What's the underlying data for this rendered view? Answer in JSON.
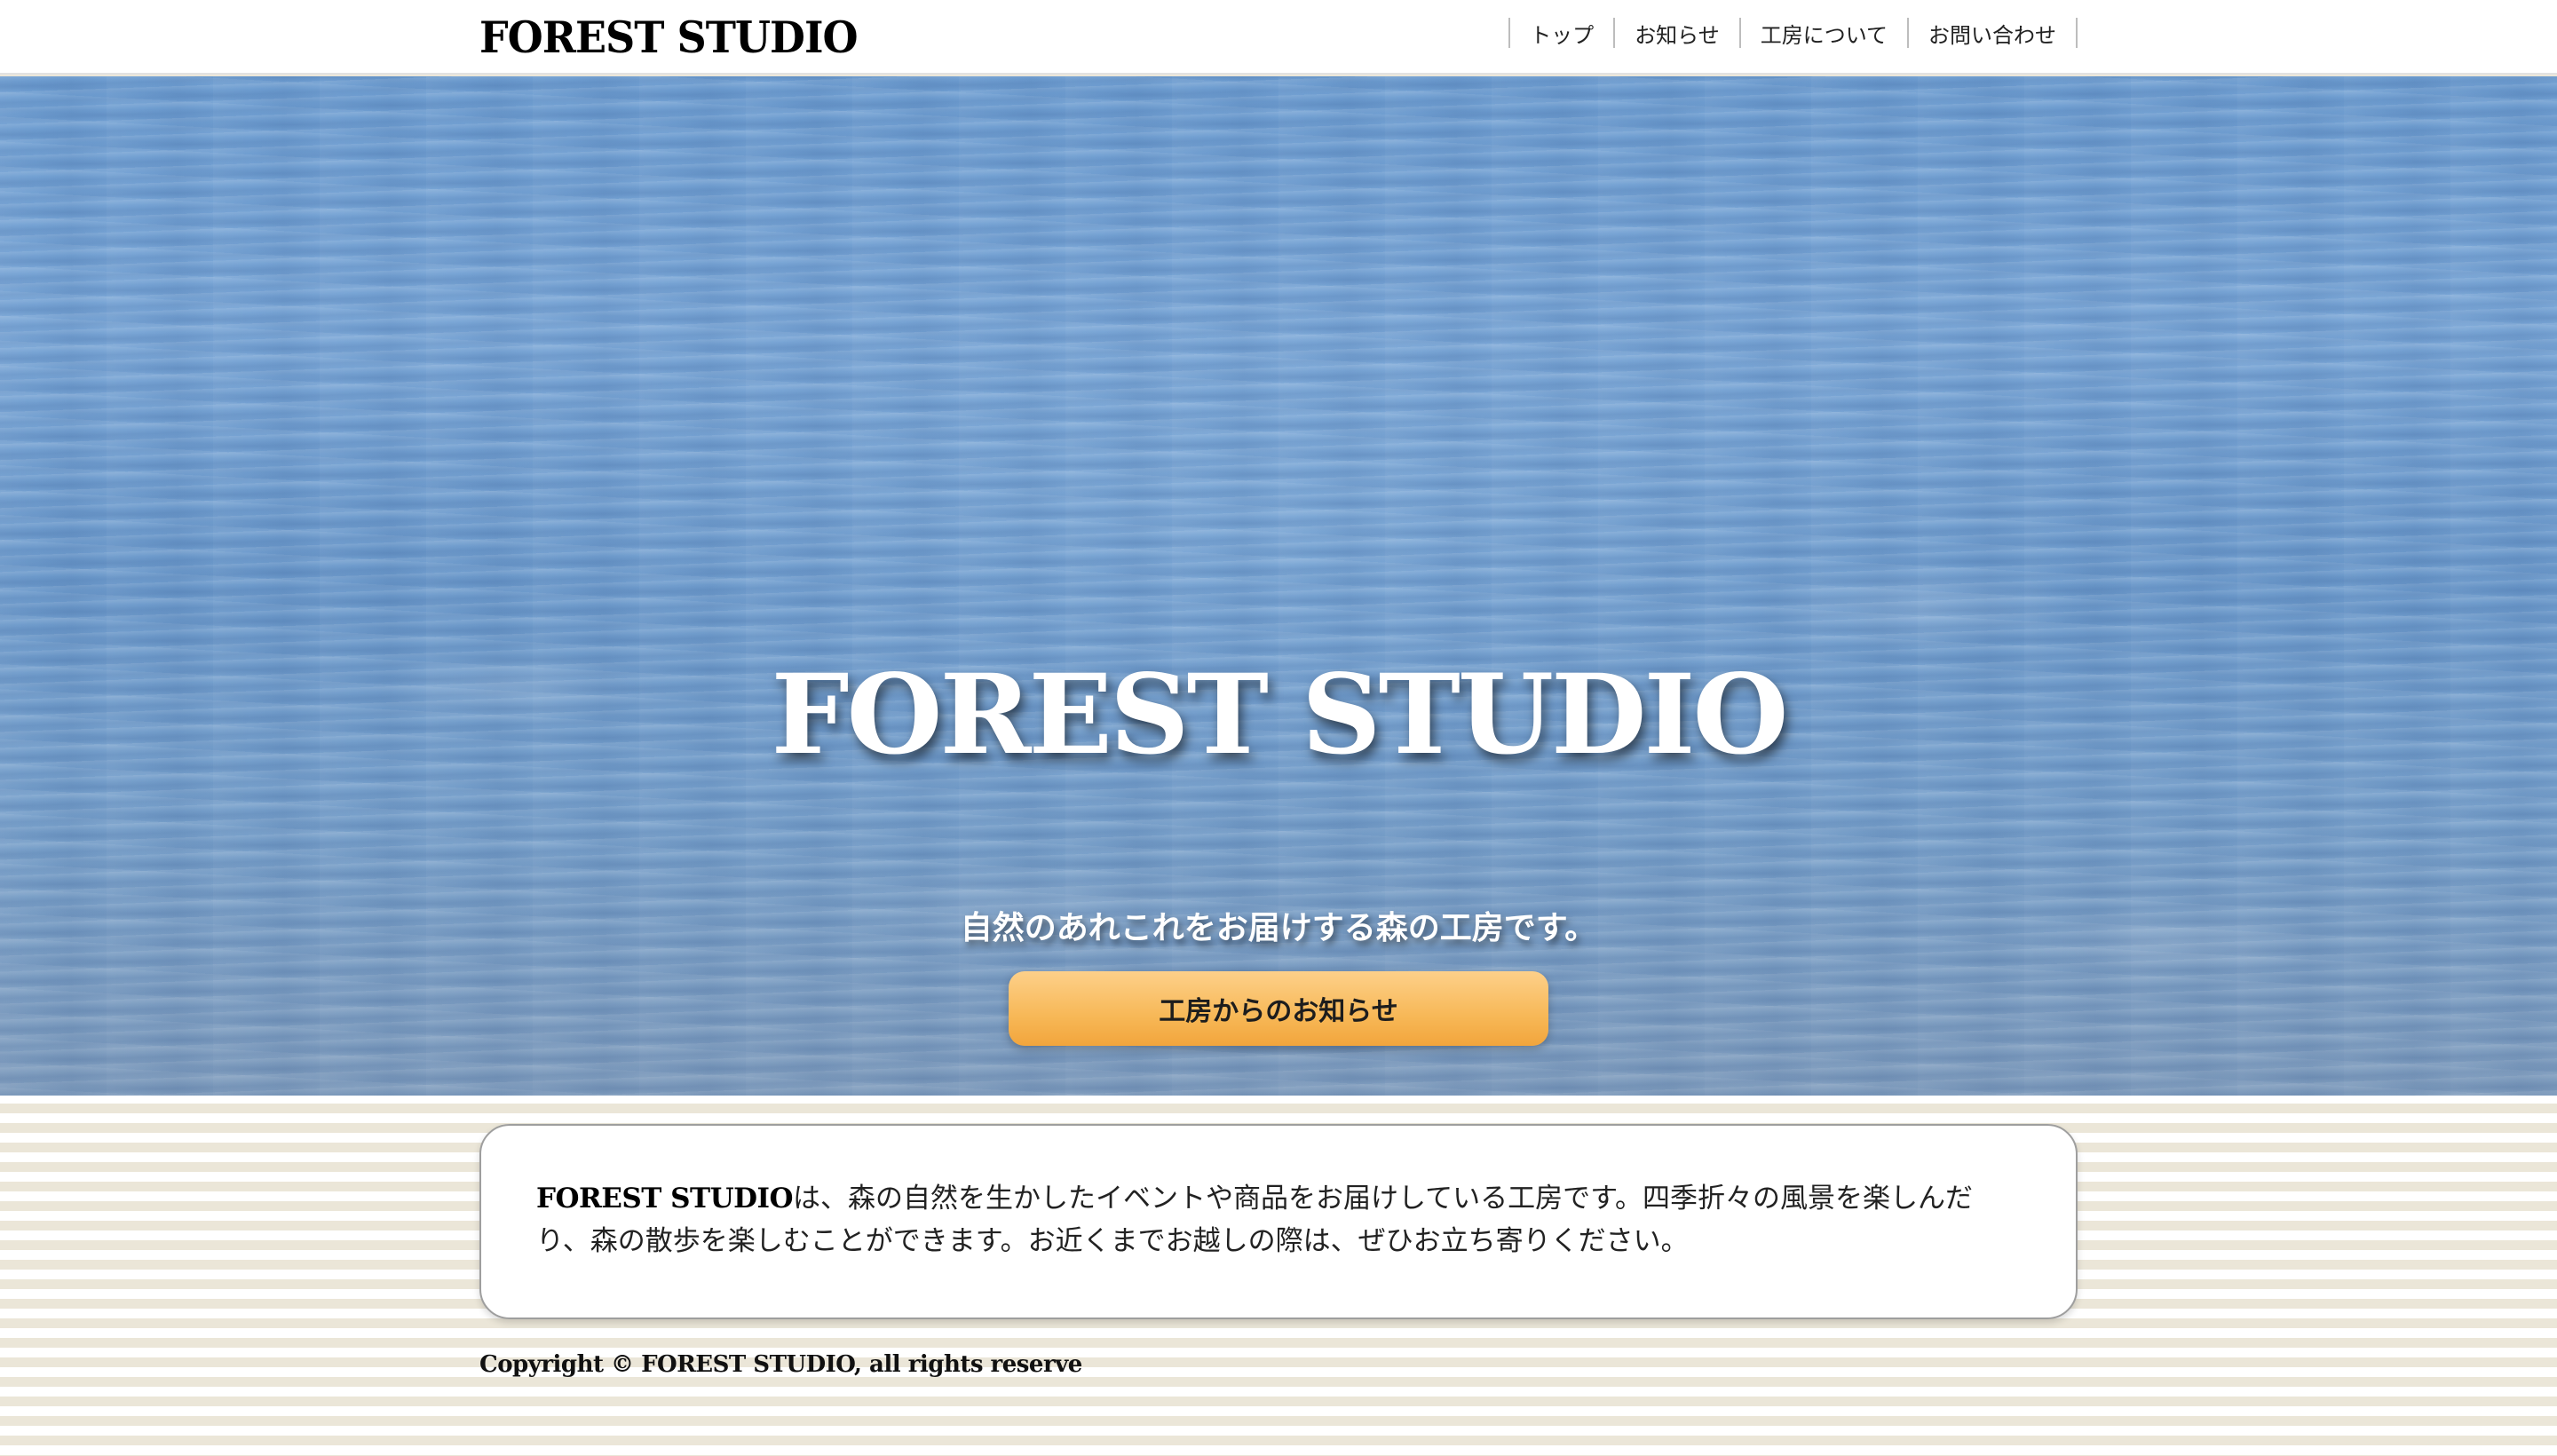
{
  "header": {
    "logo": "FOREST STUDIO",
    "nav": [
      {
        "label": "トップ"
      },
      {
        "label": "お知らせ"
      },
      {
        "label": "工房について"
      },
      {
        "label": "お問い合わせ"
      }
    ]
  },
  "hero": {
    "title": "FOREST STUDIO",
    "subtitle": "自然のあれこれをお届けする森の工房です。",
    "button_label": "工房からのお知らせ"
  },
  "intro": {
    "brand": "FOREST STUDIO",
    "text": "は、森の自然を生かしたイベントや商品をお届けしている工房です。四季折々の風景を楽しんだり、森の散歩を楽しむことができます。お近くまでお越しの際は、ぜひお立ち寄りください。"
  },
  "footer": {
    "copyright": "Copyright © FOREST STUDIO, all rights reserve"
  },
  "colors": {
    "button_gradient_top": "#fdd08a",
    "button_gradient_bottom": "#f2a53c",
    "hero_water": "#7aa6d6",
    "stripe_light": "#ffffff",
    "stripe_dark": "#ebe6d8"
  }
}
